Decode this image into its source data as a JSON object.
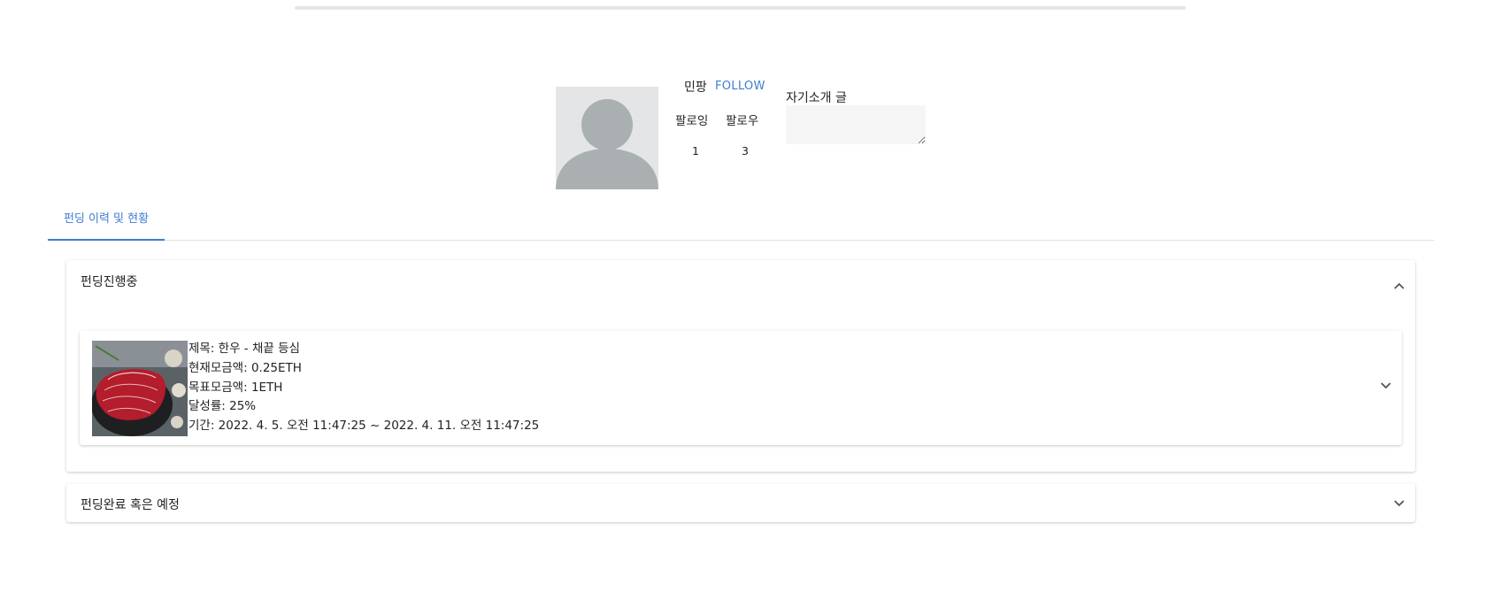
{
  "profile": {
    "name": "민팡",
    "follow_label": "FOLLOW",
    "following_label": "팔로잉",
    "follower_label": "팔로우",
    "following_count": "1",
    "follower_count": "3",
    "bio_label": "자기소개 글",
    "bio_value": ""
  },
  "tabs": [
    {
      "label": "펀딩 이력 및 현황"
    }
  ],
  "sections": {
    "ongoing": {
      "title": "펀딩진행중",
      "expanded": true,
      "items": [
        {
          "title_line": "제목: 한우 - 채끝 등심",
          "current_line": "현재모금액: 0.25ETH",
          "goal_line": "목표모금액: 1ETH",
          "rate_line": "달성률: 25%",
          "period_line": "기간: 2022. 4. 5. 오전 11:47:25 ~ 2022. 4. 11. 오전 11:47:25",
          "image": "beef-steak-photo"
        }
      ]
    },
    "completed": {
      "title": "펀딩완료 혹은 예정",
      "expanded": false
    }
  },
  "icons": {
    "collapse": "chevron-up-icon",
    "expand": "chevron-down-icon"
  },
  "colors": {
    "accent": "#3f7dd0",
    "avatar_bg": "#e3e5e6",
    "avatar_fg": "#aab0b1"
  }
}
